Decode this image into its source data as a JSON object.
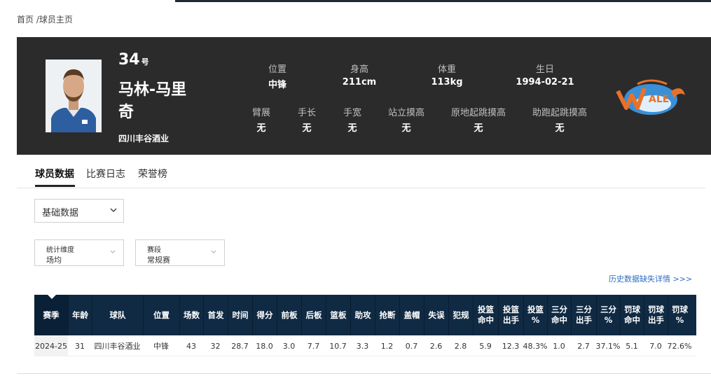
{
  "breadcrumb": {
    "home": "首页",
    "sep": " /",
    "current": "球员主页"
  },
  "player": {
    "number": "34",
    "number_suffix": "号",
    "name_line1": "马林-马里",
    "name_line2": "奇",
    "team": "四川丰谷酒业"
  },
  "stats_row1": [
    {
      "label": "位置",
      "value": "中锋"
    },
    {
      "label": "身高",
      "value": "211cm"
    },
    {
      "label": "体重",
      "value": "113kg"
    },
    {
      "label": "生日",
      "value": "1994-02-21"
    }
  ],
  "stats_row2": [
    {
      "label": "臂展",
      "value": "无"
    },
    {
      "label": "手长",
      "value": "无"
    },
    {
      "label": "手宽",
      "value": "无"
    },
    {
      "label": "站立摸高",
      "value": "无"
    },
    {
      "label": "原地起跳摸高",
      "value": "无"
    },
    {
      "label": "助跑起跳摸高",
      "value": "无"
    }
  ],
  "tabs": [
    {
      "label": "球员数据",
      "active": true
    },
    {
      "label": "比赛日志",
      "active": false
    },
    {
      "label": "荣誉榜",
      "active": false
    }
  ],
  "data_type_select": {
    "value": "基础数据"
  },
  "filters": [
    {
      "label": "统计维度",
      "value": "场均"
    },
    {
      "label": "赛段",
      "value": "常规赛"
    }
  ],
  "history_link": "历史数据缺失详情 >>>",
  "table": {
    "headers": [
      [
        "赛季"
      ],
      [
        "年龄"
      ],
      [
        "球队"
      ],
      [
        "位置"
      ],
      [
        "场数"
      ],
      [
        "首发"
      ],
      [
        "时间"
      ],
      [
        "得分"
      ],
      [
        "前板"
      ],
      [
        "后板"
      ],
      [
        "篮板"
      ],
      [
        "助攻"
      ],
      [
        "抢断"
      ],
      [
        "盖帽"
      ],
      [
        "失误"
      ],
      [
        "犯规"
      ],
      [
        "投篮",
        "命中"
      ],
      [
        "投篮",
        "出手"
      ],
      [
        "投篮",
        "%"
      ],
      [
        "三分",
        "命中"
      ],
      [
        "三分",
        "出手"
      ],
      [
        "三分",
        "%"
      ],
      [
        "罚球",
        "命中"
      ],
      [
        "罚球",
        "出手"
      ],
      [
        "罚球",
        "%"
      ]
    ],
    "rows": [
      [
        "2024-25",
        "31",
        "四川丰谷酒业",
        "中锋",
        "43",
        "32",
        "28.7",
        "18.0",
        "3.0",
        "7.7",
        "10.7",
        "3.3",
        "1.2",
        "0.7",
        "2.6",
        "2.8",
        "5.9",
        "12.3",
        "48.3%",
        "1.0",
        "2.7",
        "37.1%",
        "5.1",
        "7.0",
        "72.6%"
      ]
    ]
  },
  "colors": {
    "hero_bg": "#2b2b2b",
    "table_header_bg": "#102a43",
    "link": "#2e6fc4",
    "logo_blue": "#3a8fd6",
    "logo_orange": "#e8712a"
  }
}
